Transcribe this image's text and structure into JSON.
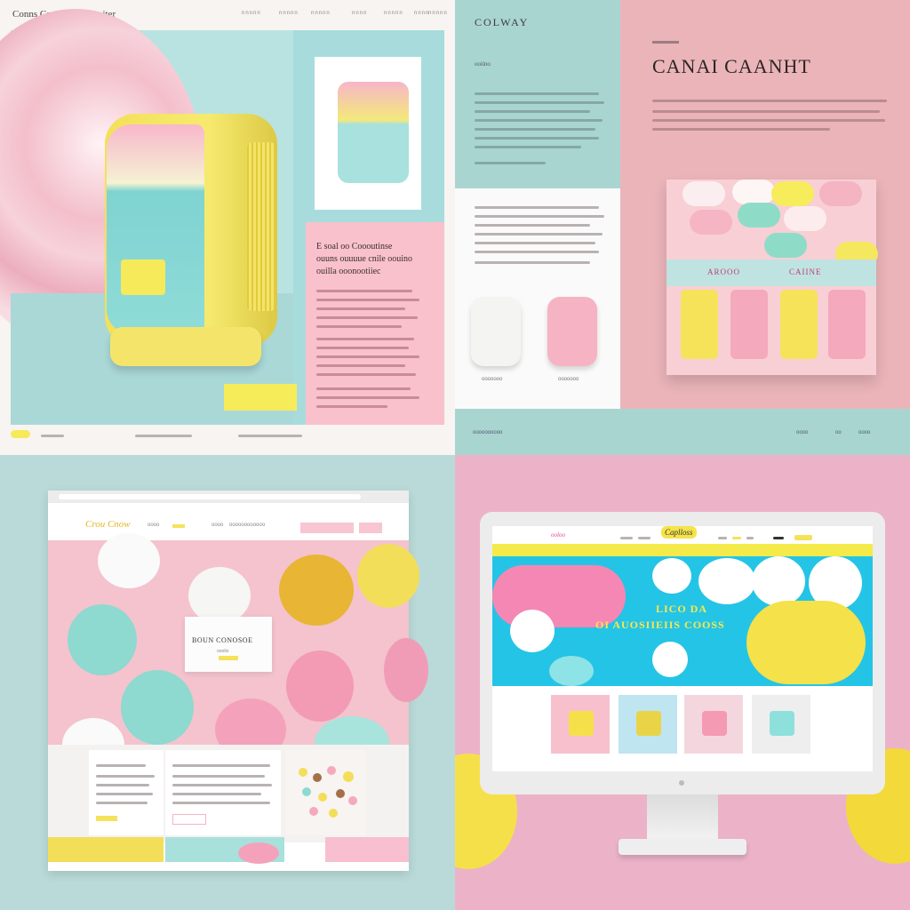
{
  "panel1": {
    "title": "Conns Caulns Cooontaiter",
    "nav": [
      "nnnnn",
      "nnnnn",
      "nnnnn",
      "nnnn",
      "nnnnn",
      "nnnn",
      "nnnnn"
    ],
    "card_heading_1": "E soal oo Coooutinse",
    "card_heading_2": "ouuns ouuuue cnile oouino",
    "card_heading_3": "ouilla ooonootiiec"
  },
  "panel2": {
    "brand": "COLWAY",
    "subtitle": "ooiino",
    "headline": "CANAI CAANHT",
    "tray_label_left": "AROOO",
    "tray_label_right": "CAIINE",
    "soap_caption_1": "ooooooo",
    "soap_caption_2": "ooooooo",
    "footer": [
      "oooooooooo",
      "oooo",
      "oo",
      "oooo"
    ]
  },
  "panel3": {
    "logo": "Crou Cnow",
    "nav": [
      "oooo",
      "oooo",
      "oooooooooooo"
    ],
    "card_title": "BOUN CONOSOE",
    "card_subtitle": "ooolio"
  },
  "panel4": {
    "logo": "Caplloss",
    "logo_small": "ooloo",
    "hero_line_1": "LICO DA",
    "hero_line_2": "OI AUOSIIEIIS COOSS"
  },
  "colors": {
    "pastel_pink": "#f4c3cd",
    "pastel_mint": "#a9d5d0",
    "pastel_yellow": "#f4e55a",
    "sky_blue": "#24c4e6"
  }
}
